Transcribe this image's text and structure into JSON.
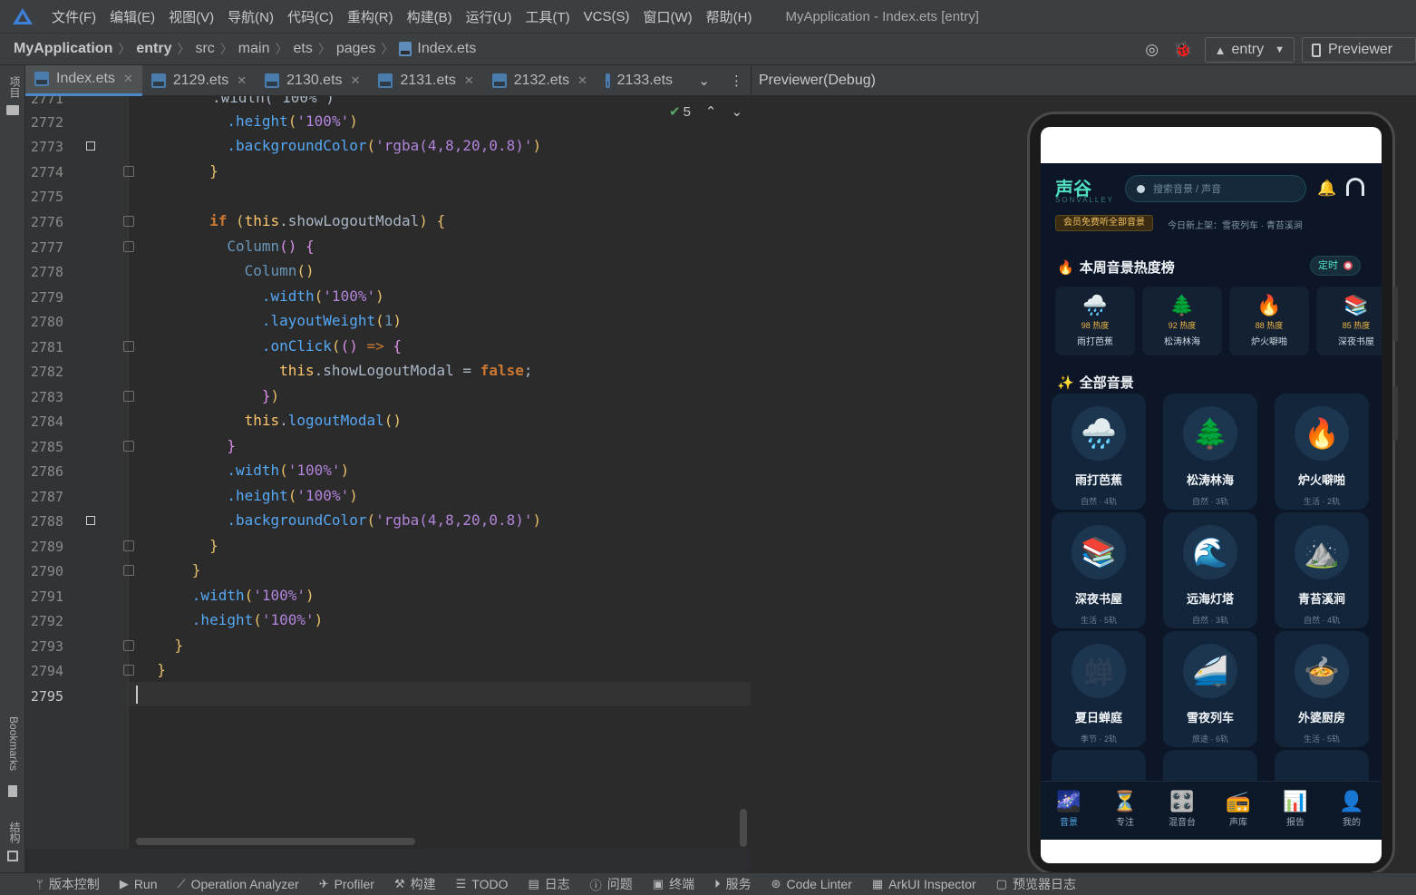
{
  "menubar": {
    "items": [
      "文件(F)",
      "编辑(E)",
      "视图(V)",
      "导航(N)",
      "代码(C)",
      "重构(R)",
      "构建(B)",
      "运行(U)",
      "工具(T)",
      "VCS(S)",
      "窗口(W)",
      "帮助(H)"
    ],
    "window_title": "MyApplication - Index.ets [entry]"
  },
  "breadcrumb": [
    "MyApplication",
    "entry",
    "src",
    "main",
    "ets",
    "pages",
    "Index.ets"
  ],
  "toolbar": {
    "module": "entry",
    "previewer": "Previewer"
  },
  "left_strip": {
    "project": "项目",
    "bookmarks": "Bookmarks",
    "structure": "结构"
  },
  "tabs": [
    {
      "label": "Index.ets",
      "active": true
    },
    {
      "label": "2129.ets"
    },
    {
      "label": "2130.ets"
    },
    {
      "label": "2131.ets"
    },
    {
      "label": "2132.ets"
    },
    {
      "label": "2133.ets"
    }
  ],
  "editor": {
    "inspection_count": "5",
    "first_line_fragment": ".width('100%')",
    "line_numbers": [
      "2771",
      "2772",
      "2773",
      "2774",
      "2775",
      "2776",
      "2777",
      "2778",
      "2779",
      "2780",
      "2781",
      "2782",
      "2783",
      "2784",
      "2785",
      "2786",
      "2787",
      "2788",
      "2789",
      "2790",
      "2791",
      "2792",
      "2793",
      "2794",
      "2795"
    ],
    "current_line": "2795"
  },
  "previewer": {
    "title": "Previewer(Debug)",
    "app": {
      "brand": "声谷",
      "brand_sub": "SONVALLEY",
      "search_placeholder": "搜索音景 / 声音",
      "vip_text": "会员免费听全部音景",
      "new_text": "今日新上架：雪夜列车 · 青苔溪涧",
      "hot_title": "本周音景热度榜",
      "timer_label": "定时",
      "hot": [
        {
          "icon": "🌧️",
          "heat": "98 热度",
          "name": "雨打芭蕉"
        },
        {
          "icon": "🌲",
          "heat": "92 热度",
          "name": "松涛林海"
        },
        {
          "icon": "🔥",
          "heat": "88 热度",
          "name": "炉火噼啪"
        },
        {
          "icon": "📚",
          "heat": "85 热度",
          "name": "深夜书屋"
        }
      ],
      "all_title": "全部音景",
      "scenes": [
        {
          "icon": "🌧️",
          "name": "雨打芭蕉",
          "meta": "自然 · 4轨"
        },
        {
          "icon": "🌲",
          "name": "松涛林海",
          "meta": "自然 · 3轨"
        },
        {
          "icon": "🔥",
          "name": "炉火噼啪",
          "meta": "生活 · 2轨"
        },
        {
          "icon": "📚",
          "name": "深夜书屋",
          "meta": "生活 · 5轨"
        },
        {
          "icon": "🌊",
          "name": "远海灯塔",
          "meta": "自然 · 3轨"
        },
        {
          "icon": "⛰️",
          "name": "青苔溪涧",
          "meta": "自然 · 4轨"
        },
        {
          "icon": "蝉",
          "name": "夏日蝉庭",
          "meta": "季节 · 2轨"
        },
        {
          "icon": "🚄",
          "name": "雪夜列车",
          "meta": "旅途 · 6轨"
        },
        {
          "icon": "🍲",
          "name": "外婆厨房",
          "meta": "生活 · 5轨"
        }
      ],
      "tabs": [
        {
          "icon": "🌌",
          "label": "音景",
          "active": true
        },
        {
          "icon": "⏳",
          "label": "专注"
        },
        {
          "icon": "🎛️",
          "label": "混音台"
        },
        {
          "icon": "📻",
          "label": "声库"
        },
        {
          "icon": "📊",
          "label": "报告"
        },
        {
          "icon": "👤",
          "label": "我的"
        }
      ]
    }
  },
  "bottom_tools": [
    "版本控制",
    "Run",
    "Operation Analyzer",
    "Profiler",
    "构建",
    "TODO",
    "日志",
    "问题",
    "终端",
    "服务",
    "Code Linter",
    "ArkUI Inspector",
    "预览器日志"
  ],
  "colors": {
    "accent": "#4a88c7",
    "app_bg": "#0c1626",
    "brand": "#4fe0c0"
  }
}
